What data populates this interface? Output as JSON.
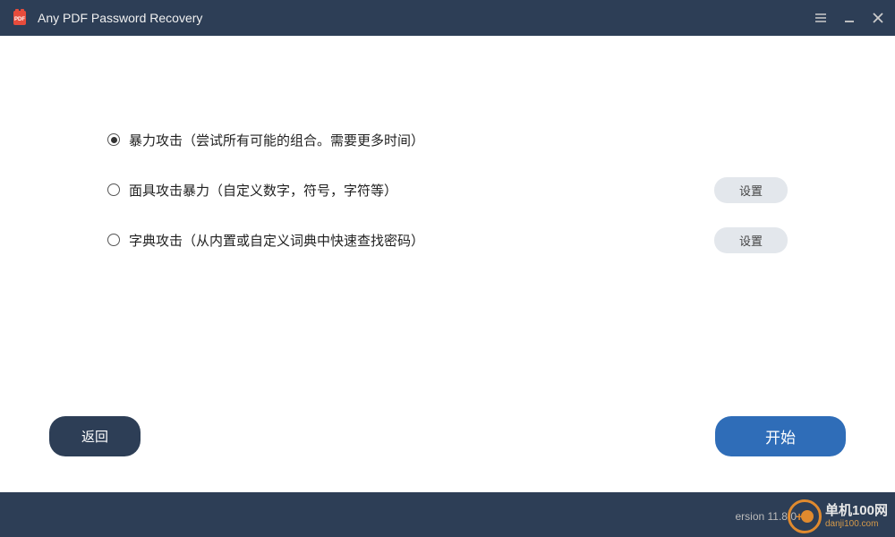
{
  "titlebar": {
    "app_title": "Any PDF Password Recovery"
  },
  "options": [
    {
      "label": "暴力攻击（尝试所有可能的组合。需要更多时间）",
      "selected": true,
      "settings_label": null
    },
    {
      "label": "面具攻击暴力（自定义数字，符号，字符等）",
      "selected": false,
      "settings_label": "设置"
    },
    {
      "label": "字典攻击（从内置或自定义词典中快速查找密码）",
      "selected": false,
      "settings_label": "设置"
    }
  ],
  "buttons": {
    "back": "返回",
    "start": "开始"
  },
  "footer": {
    "version": "ersion 11.8.0",
    "watermark_cn": "单机100网",
    "watermark_en": "danji100.com"
  }
}
